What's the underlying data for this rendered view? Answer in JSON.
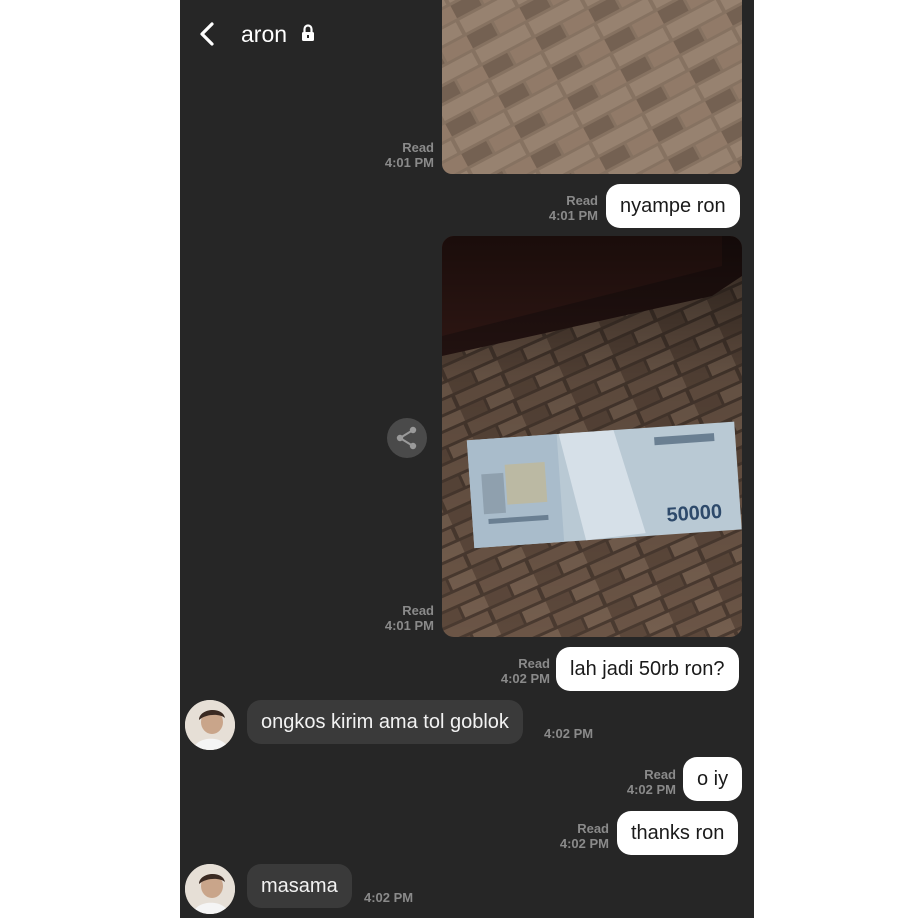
{
  "header": {
    "contact_name": "aron"
  },
  "icons": {
    "back": "chevron-left-icon",
    "lock": "lock-icon",
    "call": "phone-icon",
    "notes": "notes-icon",
    "menu": "chevron-down-icon",
    "share": "share-icon"
  },
  "messages": [
    {
      "type": "image",
      "direction": "out",
      "status": "Read",
      "time": "4:01 PM",
      "content": "photo of brick wall"
    },
    {
      "type": "text",
      "direction": "out",
      "status": "Read",
      "time": "4:01 PM",
      "text": "nyampe ron"
    },
    {
      "type": "image",
      "direction": "out",
      "status": "Read",
      "time": "4:01 PM",
      "content": "photo of banknote on tiled floor",
      "banknote_value": "50000"
    },
    {
      "type": "text",
      "direction": "out",
      "status": "Read",
      "time": "4:02 PM",
      "text": "lah jadi 50rb ron?"
    },
    {
      "type": "text",
      "direction": "in",
      "time": "4:02 PM",
      "text": "ongkos kirim ama tol goblok"
    },
    {
      "type": "text",
      "direction": "out",
      "status": "Read",
      "time": "4:02 PM",
      "text": "o iy"
    },
    {
      "type": "text",
      "direction": "out",
      "status": "Read",
      "time": "4:02 PM",
      "text": "thanks ron"
    },
    {
      "type": "text",
      "direction": "in",
      "time": "4:02 PM",
      "text": "masama"
    }
  ],
  "colors": {
    "background": "#262626",
    "outgoing_bubble": "#ffffff",
    "incoming_bubble": "#3a3a3a",
    "meta_text": "#8a8a8a"
  }
}
